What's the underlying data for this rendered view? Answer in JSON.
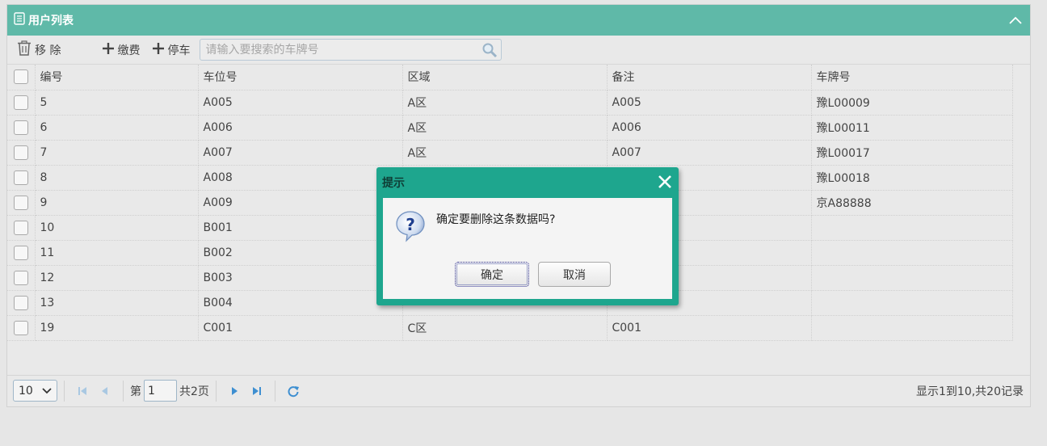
{
  "panel": {
    "title": "用户列表"
  },
  "toolbar": {
    "remove_label": "移 除",
    "pay_label": "缴费",
    "park_label": "停车",
    "search_placeholder": "请输入要搜索的车牌号"
  },
  "table": {
    "columns": [
      "编号",
      "车位号",
      "区域",
      "备注",
      "车牌号"
    ],
    "rows": [
      [
        "5",
        "A005",
        "A区",
        "A005",
        "豫L00009"
      ],
      [
        "6",
        "A006",
        "A区",
        "A006",
        "豫L00011"
      ],
      [
        "7",
        "A007",
        "A区",
        "A007",
        "豫L00017"
      ],
      [
        "8",
        "A008",
        "",
        "",
        "豫L00018"
      ],
      [
        "9",
        "A009",
        "",
        "",
        "京A88888"
      ],
      [
        "10",
        "B001",
        "",
        "",
        ""
      ],
      [
        "11",
        "B002",
        "",
        "",
        ""
      ],
      [
        "12",
        "B003",
        "",
        "",
        ""
      ],
      [
        "13",
        "B004",
        "",
        "",
        ""
      ],
      [
        "19",
        "C001",
        "C区",
        "C001",
        ""
      ]
    ]
  },
  "pager": {
    "page_size": "10",
    "page_prefix": "第",
    "current_page": "1",
    "total_pages": "共2页",
    "info": "显示1到10,共20记录"
  },
  "dialog": {
    "title": "提示",
    "message": "确定要删除这条数据吗?",
    "ok_label": "确定",
    "cancel_label": "取消"
  },
  "colors": {
    "header_bg": "#5fb9a8",
    "dialog_frame": "#1ea68e",
    "pager_icon": "#3e8fd1"
  }
}
